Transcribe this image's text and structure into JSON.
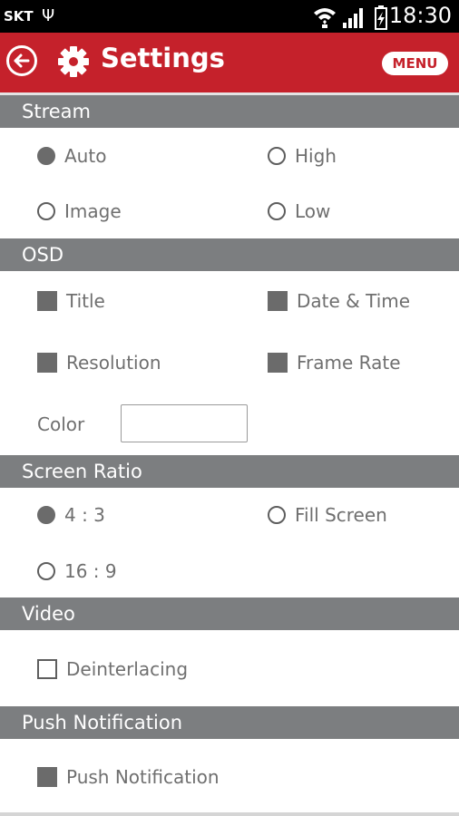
{
  "status_bar": {
    "carrier": "SKT",
    "usb_symbol": "Ψ",
    "time": "18:30"
  },
  "header": {
    "title": "Settings",
    "menu_label": "MENU"
  },
  "sections": {
    "stream": {
      "title": "Stream",
      "options": [
        {
          "label": "Auto",
          "checked": true
        },
        {
          "label": "High",
          "checked": false
        },
        {
          "label": "Image",
          "checked": false
        },
        {
          "label": "Low",
          "checked": false
        }
      ]
    },
    "osd": {
      "title": "OSD",
      "options": [
        {
          "label": "Title",
          "checked": true
        },
        {
          "label": "Date & Time",
          "checked": true
        },
        {
          "label": "Resolution",
          "checked": true
        },
        {
          "label": "Frame Rate",
          "checked": true
        }
      ],
      "color_label": "Color",
      "color_value": ""
    },
    "screen_ratio": {
      "title": "Screen Ratio",
      "options": [
        {
          "label": "4 : 3",
          "checked": true
        },
        {
          "label": "Fill Screen",
          "checked": false
        },
        {
          "label": "16 : 9",
          "checked": false
        }
      ]
    },
    "video": {
      "title": "Video",
      "options": [
        {
          "label": "Deinterlacing",
          "checked": false
        }
      ]
    },
    "push": {
      "title": "Push Notification",
      "options": [
        {
          "label": "Push Notification",
          "checked": true
        }
      ]
    }
  },
  "colors": {
    "brand": "#c5212b",
    "section_header": "#7c7e80",
    "control": "#6b6b6b",
    "text": "#6f6f6f"
  }
}
